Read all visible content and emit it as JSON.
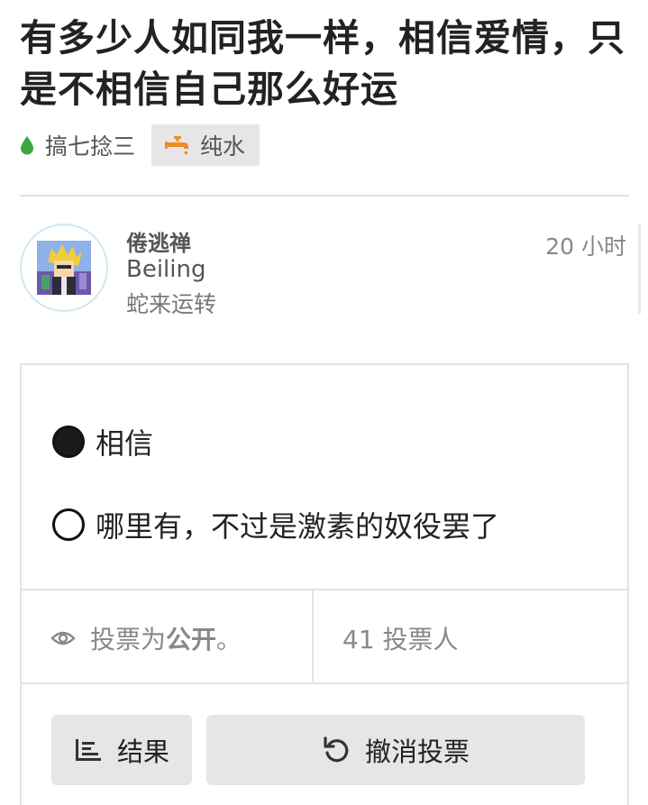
{
  "post": {
    "title": "有多少人如同我一样，相信爱情，只是不相信自己那么好运",
    "category": "搞七捻三",
    "tag": "纯水"
  },
  "author": {
    "name": "倦逃禅",
    "location": "Beiling",
    "status": "蛇来运转",
    "time": "20 小时"
  },
  "poll": {
    "options": [
      {
        "label": "相信",
        "selected": true
      },
      {
        "label": "哪里有，不过是激素的奴役罢了",
        "selected": false
      }
    ],
    "visibility_prefix": "投票为",
    "visibility_strong": "公开",
    "visibility_suffix": "。",
    "voters": "41 投票人",
    "results_label": "结果",
    "revoke_label": "撤消投票"
  },
  "colors": {
    "category_dot": "#3aa845",
    "tag_icon": "#f08a24",
    "accent_border": "#cfe8f3"
  },
  "icons": {
    "category": "drop-icon",
    "tag": "faucet-icon",
    "visibility": "eye-icon",
    "results": "bar-list-icon",
    "revoke": "undo-icon"
  }
}
